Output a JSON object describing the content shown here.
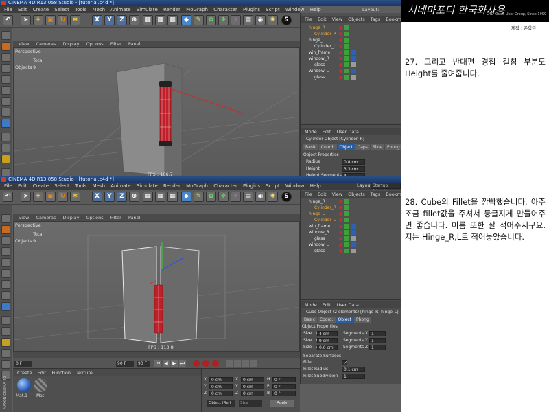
{
  "brand": {
    "logo_text": "시네마포디 한국화사용",
    "tagline": "C4D Korea User Group, Since 1999",
    "credit": "제작 : 은학란"
  },
  "top_shot": {
    "window_title": "CINEMA 4D R13.058 Studio - [tutorial.c4d *]",
    "menu": [
      "File",
      "Edit",
      "Create",
      "Select",
      "Tools",
      "Mesh",
      "Animate",
      "Simulate",
      "Render",
      "MoGraph",
      "Character",
      "Plugins",
      "Script",
      "Window",
      "Help"
    ],
    "layout_label": "Layout:",
    "layout_value": "Startup (User)",
    "toolbar_letters": [
      "X",
      "Y",
      "Z"
    ],
    "viewport_menu": [
      "View",
      "Cameras",
      "Display",
      "Options",
      "Filter",
      "Panel"
    ],
    "viewport_label": "Perspective",
    "hud_total": "Total",
    "hud_objects_label": "Objects",
    "hud_objects_value": "9",
    "fps": "FPS : 166.7",
    "object_manager_menu": [
      "File",
      "Edit",
      "View",
      "Objects",
      "Tags",
      "Bookmarks"
    ],
    "objects": [
      "hinge_R",
      "Cylinder_R",
      "hinge_L",
      "Cylinder_L",
      "win_frame",
      "window_R",
      "glass",
      "window_L",
      "glass"
    ],
    "attr_menu": [
      "Mode",
      "Edit",
      "User Data"
    ],
    "attr_object_title": "Cylinder Object [Cylinder_R]",
    "attr_tabs": [
      "Basic",
      "Coord.",
      "Object",
      "Caps",
      "Slice",
      "Phong"
    ],
    "attr_active_tab": "Object",
    "attr_section": "Object Properties",
    "attr_fields": [
      {
        "label": "Radius",
        "value": "0.8 cm"
      },
      {
        "label": "Height",
        "value": "3.3 cm"
      },
      {
        "label": "Height Segments",
        "value": "4"
      }
    ]
  },
  "bottom_shot": {
    "window_title": "CINEMA 4D R13.058 Studio - [tutorial.c4d *]",
    "menu": [
      "File",
      "Edit",
      "Create",
      "Select",
      "Tools",
      "Mesh",
      "Animate",
      "Simulate",
      "Render",
      "MoGraph",
      "Character",
      "Plugins",
      "Script",
      "Window",
      "Help"
    ],
    "layout_label": "Layout:",
    "layout_value": "Startup (User)",
    "toolbar_letters": [
      "X",
      "Y",
      "Z"
    ],
    "viewport_menu": [
      "View",
      "Cameras",
      "Display",
      "Options",
      "Filter",
      "Panel"
    ],
    "viewport_label": "Perspective",
    "hud_total": "Total",
    "hud_objects_label": "Objects",
    "hud_objects_value": "9",
    "fps": "FPS : 113.8",
    "object_manager_menu": [
      "File",
      "Edit",
      "View",
      "Objects",
      "Tags",
      "Bookmarks"
    ],
    "objects": [
      "hinge_R",
      "Cylinder_R",
      "hinge_L",
      "Cylinder_L",
      "win_frame",
      "window_R",
      "glass",
      "window_L",
      "glass"
    ],
    "attr_menu": [
      "Mode",
      "Edit",
      "User Data"
    ],
    "attr_object_title": "Cube Object (2 elements) [hinge_R, hinge_L]",
    "attr_tabs": [
      "Basic",
      "Coord.",
      "Object",
      "Phong"
    ],
    "attr_active_tab": "Object",
    "attr_section": "Object Properties",
    "attr_fields": [
      {
        "label": "Size . X",
        "value": "4 cm",
        "seg_label": "Segments X",
        "seg_value": "1"
      },
      {
        "label": "Size . Y",
        "value": "9 cm",
        "seg_label": "Segments Y",
        "seg_value": "1"
      },
      {
        "label": "Size . Z",
        "value": "0.6 cm",
        "seg_label": "Segments Z",
        "seg_value": "1"
      }
    ],
    "separate_surfaces": "Separate Surfaces",
    "fillet_label": "Fillet",
    "fillet_radius_label": "Fillet Radius",
    "fillet_radius_value": "0.1 cm",
    "fillet_subdiv_label": "Fillet Subdivision",
    "fillet_subdiv_value": "1",
    "timeline": {
      "start": "0 F",
      "current": "90 F",
      "end": "90 F"
    },
    "material_menu": [
      "Create",
      "Edit",
      "Function",
      "Texture"
    ],
    "materials": [
      "Mat.1",
      "Mat"
    ],
    "coords": {
      "rows": [
        {
          "axis": "X",
          "pos": "0 cm",
          "size_axis": "X",
          "size": "0 cm",
          "rot_axis": "H",
          "rot": "0 °"
        },
        {
          "axis": "Y",
          "pos": "0 cm",
          "size_axis": "Y",
          "size": "0 cm",
          "rot_axis": "P",
          "rot": "0 °"
        },
        {
          "axis": "Z",
          "pos": "0 cm",
          "size_axis": "Z",
          "size": "0 cm",
          "rot_axis": "B",
          "rot": "0 °"
        }
      ],
      "mode": "Object (Rel)",
      "size_mode": "Size",
      "apply": "Apply"
    },
    "side_logo": "MAXON CINEMA 4D"
  },
  "captions": {
    "step27": "27. 그리고 반대편 경첩 걸침 부분도 Height를 줄여줍니다.",
    "step28": "28. Cube의 Fillet을 깜빡했습니다. 아주 조금 fillet값을 주셔서 둥글지게 만들어주면 좋습니다. 이름 또한 잘 적어주시구요. 저는 Hinge_R,L로 적어놓았습니다."
  },
  "colors": {
    "ui_bg": "#5e5e5e",
    "title_blue": "#1b3766",
    "active_tab": "#2d5c9a",
    "cylinder_red": "#c0202a",
    "brand_black": "#000000"
  }
}
